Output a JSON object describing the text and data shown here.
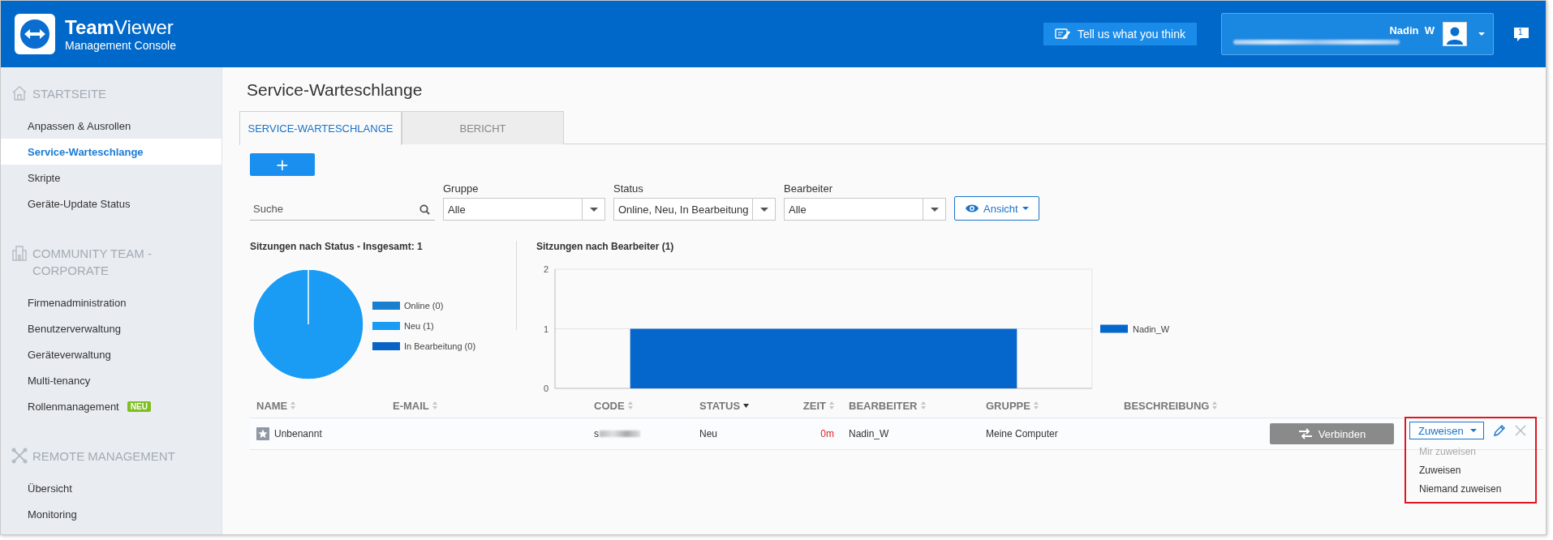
{
  "header": {
    "brand": "**Team**Viewer",
    "subtitle": "Management Console",
    "feedback_button": "Tell us what you think",
    "user": {
      "name": "Nadin  W"
    },
    "notifications": {
      "count": "1"
    }
  },
  "sidebar": {
    "sections": [
      {
        "title": "STARTSEITE",
        "kind": "home",
        "items": [
          {
            "label": "Anpassen & Ausrollen",
            "selected": false
          },
          {
            "label": "Service-Warteschlange",
            "selected": true
          },
          {
            "label": "Skripte",
            "selected": false
          },
          {
            "label": "Geräte-Update Status",
            "selected": false
          }
        ]
      },
      {
        "title": "COMMUNITY TEAM - CORPORATE",
        "kind": "company",
        "items": [
          {
            "label": "Firmenadministration",
            "selected": false
          },
          {
            "label": "Benutzerverwaltung",
            "selected": false
          },
          {
            "label": "Geräteverwaltung",
            "selected": false
          },
          {
            "label": "Multi-tenancy",
            "selected": false
          },
          {
            "label": "Rollenmanagement",
            "selected": false,
            "badge": "NEU"
          }
        ]
      },
      {
        "title": "REMOTE MANAGEMENT",
        "kind": "remote",
        "items": [
          {
            "label": "Übersicht",
            "selected": false
          },
          {
            "label": "Monitoring",
            "selected": false
          }
        ]
      }
    ]
  },
  "page": {
    "title": "Service-Warteschlange"
  },
  "tabs": [
    {
      "label": "SERVICE-WARTESCHLANGE",
      "selected": true
    },
    {
      "label": "BERICHT",
      "selected": false
    }
  ],
  "add_button": "+",
  "filters": {
    "search": {
      "placeholder": "Suche"
    },
    "selects": [
      {
        "label": "Gruppe",
        "value": "Alle"
      },
      {
        "label": "Status",
        "value": "Online, Neu, In Bearbeitung"
      },
      {
        "label": "Bearbeiter",
        "value": "Alle"
      }
    ],
    "view_button": "Ansicht"
  },
  "status_chart": {
    "title": "Sitzungen nach Status - Insgesamt: 1",
    "chart_data": {
      "type": "pie",
      "categories": [
        "Online (0)",
        "Neu (1)",
        "In Bearbeitung (0)"
      ],
      "values": [
        0,
        1,
        0
      ]
    }
  },
  "agent_chart": {
    "title": "Sitzungen nach Bearbeiter (1)",
    "chart_data": {
      "type": "bar",
      "ylim": [
        0,
        2
      ],
      "yticks": [
        0,
        1,
        2
      ],
      "series": [
        {
          "name": "Nadin_W",
          "color": "#0566cc",
          "values": [
            1
          ]
        }
      ]
    }
  },
  "table": {
    "columns": [
      {
        "label": "NAME",
        "sorted": false
      },
      {
        "label": "E-MAIL",
        "sorted": false
      },
      {
        "label": "CODE",
        "sorted": false
      },
      {
        "label": "STATUS",
        "sorted": true
      },
      {
        "label": "ZEIT",
        "sorted": false
      },
      {
        "label": "BEARBEITER",
        "sorted": false
      },
      {
        "label": "GRUPPE",
        "sorted": false
      },
      {
        "label": "BESCHREIBUNG",
        "sorted": false
      }
    ],
    "rows": [
      {
        "name": "Unbenannt",
        "code": "s",
        "status": "Neu",
        "time": "0m",
        "agent": "Nadin_W",
        "group": "Meine Computer",
        "connect_button": "Verbinden",
        "assign_button": "Zuweisen",
        "highlighted": true,
        "menu": [
          {
            "label": "Mir zuweisen",
            "disabled": true
          },
          {
            "label": "Zuweisen",
            "disabled": false
          },
          {
            "label": "Niemand zuweisen",
            "disabled": false
          }
        ]
      }
    ]
  }
}
